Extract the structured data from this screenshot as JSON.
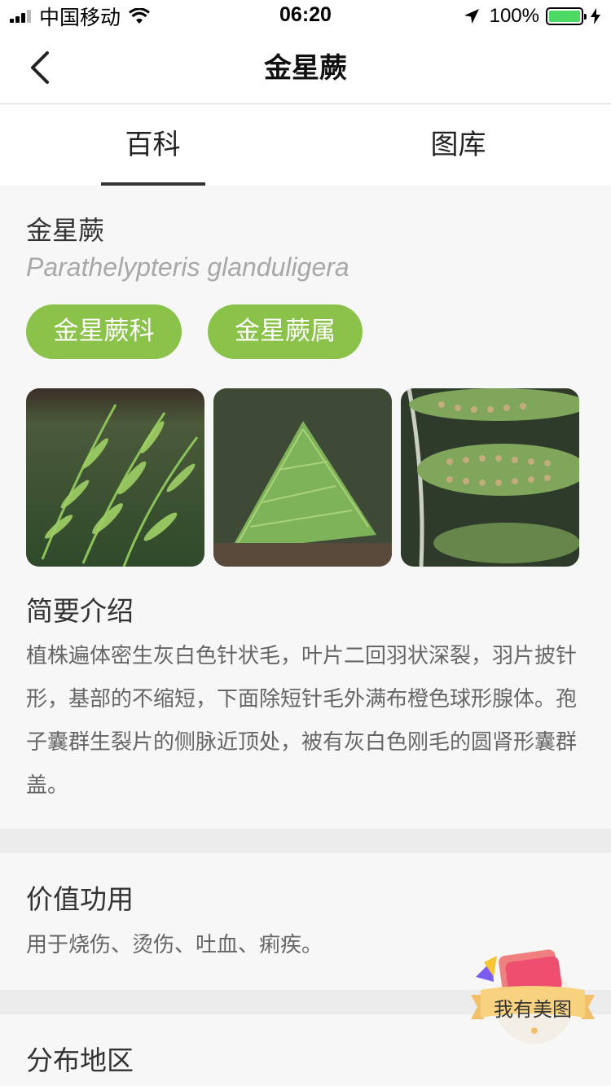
{
  "status_bar": {
    "carrier": "中国移动",
    "time": "06:20",
    "battery": "100%"
  },
  "nav": {
    "title": "金星蕨"
  },
  "tabs": [
    {
      "label": "百科"
    },
    {
      "label": "图库"
    }
  ],
  "plant": {
    "name": "金星蕨",
    "latin": "Parathelypteris glanduligera",
    "tags": [
      "金星蕨科",
      "金星蕨属"
    ]
  },
  "intro": {
    "heading": "简要介绍",
    "text": "植株遍体密生灰白色针状毛，叶片二回羽状深裂，羽片披针形，基部的不缩短，下面除短针毛外满布橙色球形腺体。孢子囊群生裂片的侧脉近顶处，被有灰白色刚毛的圆肾形囊群盖。"
  },
  "value": {
    "heading": "价值功用",
    "text": "用于烧伤、烫伤、吐血、痢疾。"
  },
  "distribution": {
    "heading": "分布地区"
  },
  "badge": {
    "label": "我有美图"
  },
  "colors": {
    "accent": "#8bc34a",
    "battery": "#4cd964"
  }
}
